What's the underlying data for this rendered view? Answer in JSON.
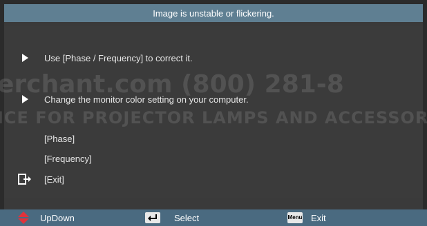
{
  "dialog": {
    "title": "Image is unstable or flickering."
  },
  "items": [
    {
      "label": "Use [Phase / Frequency] to correct it."
    },
    {
      "label": "Change the monitor color setting on your computer."
    }
  ],
  "options": [
    {
      "label": "[Phase]"
    },
    {
      "label": "[Frequency]"
    },
    {
      "label": "[Exit]"
    }
  ],
  "watermark": {
    "line1": "erchant.com (800) 281-8",
    "line2": "ICE FOR PROJECTOR LAMPS AND ACCESSORI"
  },
  "footer": {
    "updown_label": "UpDown",
    "select_label": "Select",
    "menu_key": "Menu",
    "exit_label": "Exit"
  },
  "colors": {
    "title_bar": "#5f7f92",
    "footer_bar": "#4a6a80",
    "updown_arrow": "#e0323b"
  }
}
